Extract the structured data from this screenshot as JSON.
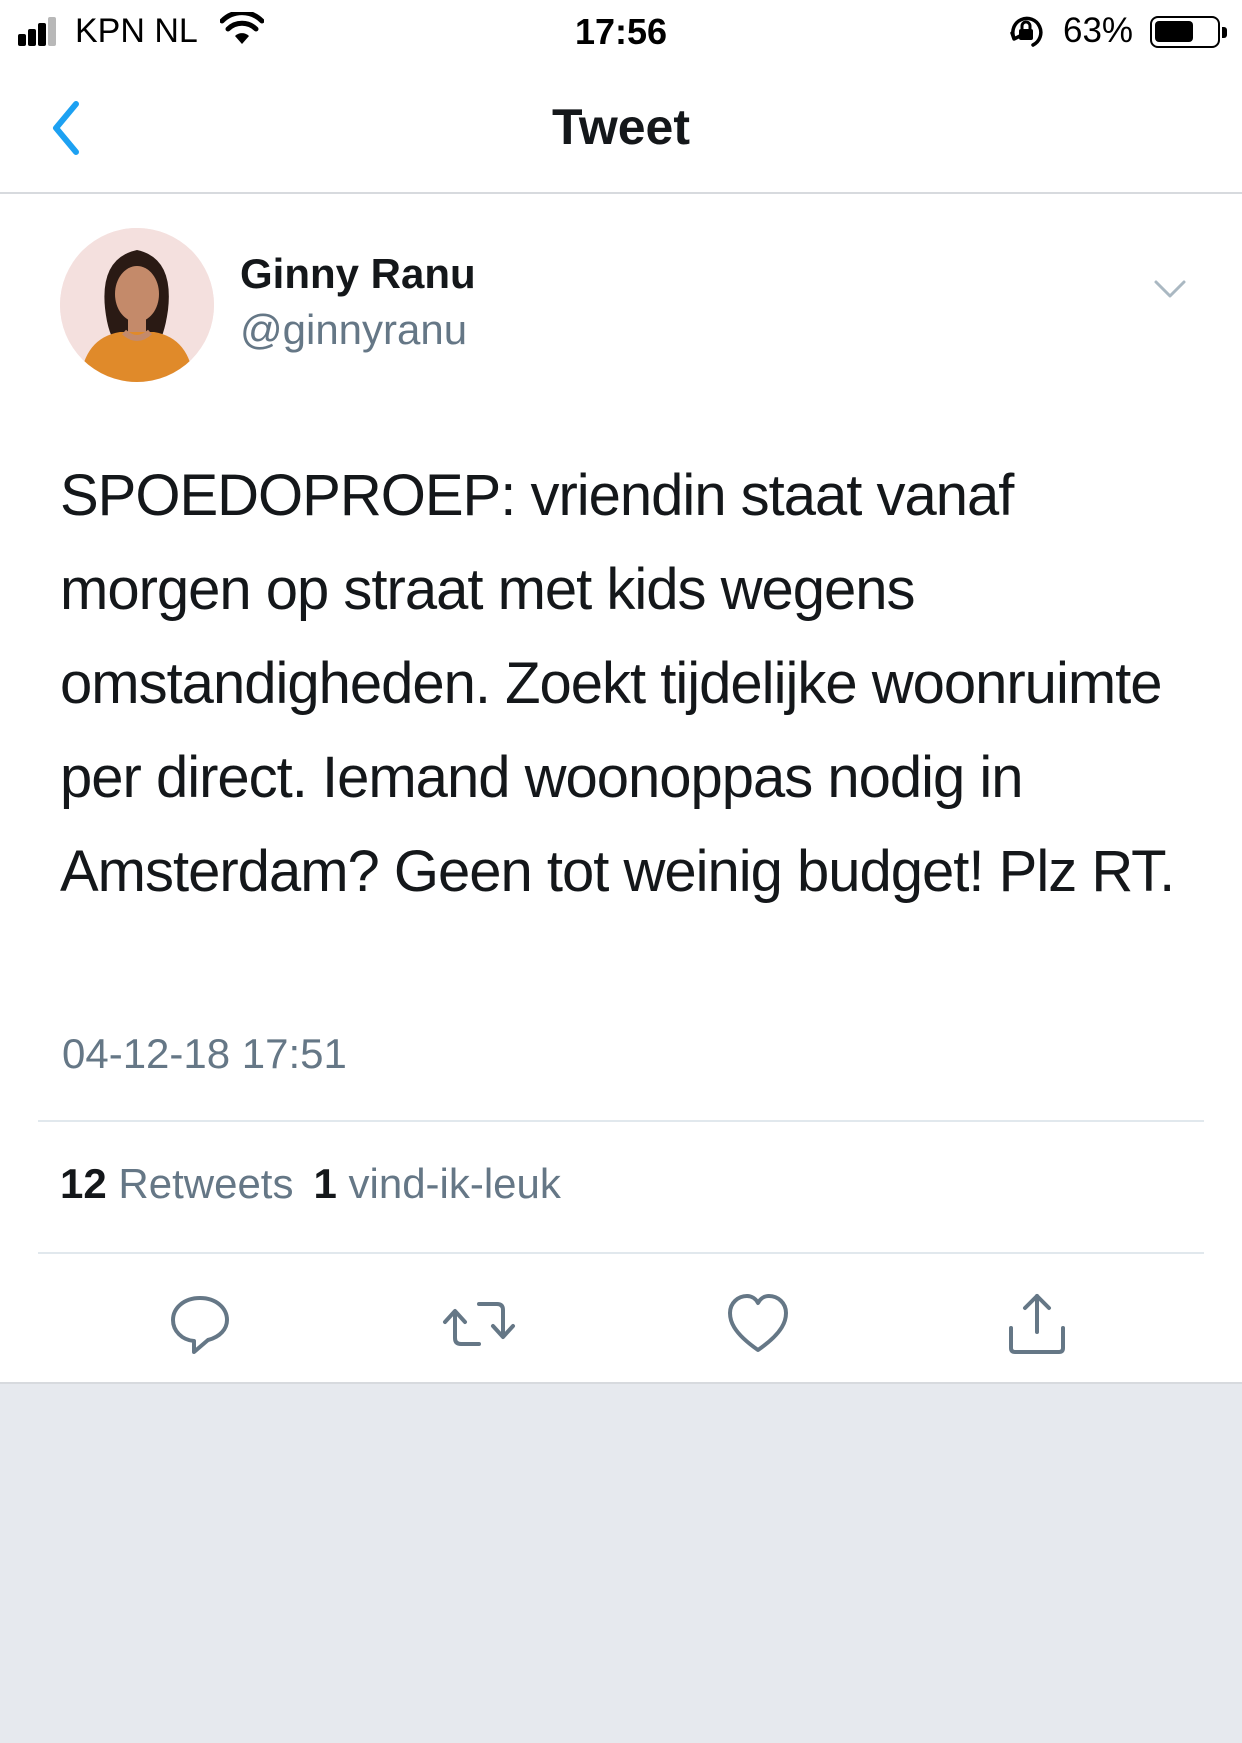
{
  "status_bar": {
    "carrier": "KPN NL",
    "time": "17:56",
    "battery_percent": "63%",
    "battery_level": 0.63,
    "icons": [
      "signal-icon",
      "wifi-icon",
      "orientation-lock-icon",
      "battery-icon"
    ]
  },
  "nav": {
    "title": "Tweet",
    "back_icon": "chevron-left-icon"
  },
  "tweet": {
    "author_name": "Ginny Ranu",
    "author_handle": "@ginnyranu",
    "text": "SPOEDOPROEP: vriendin staat vanaf morgen op straat met kids wegens omstandigheden. Zoekt tijdelijke woonruimte per direct. Iemand woonoppas nodig in Amsterdam? Geen tot weinig budget! Plz RT.",
    "timestamp": "04-12-18 17:51",
    "retweet_count": "12",
    "retweet_label": "Retweets",
    "like_count": "1",
    "like_label": "vind-ik-leuk"
  },
  "actions": [
    "reply-icon",
    "retweet-icon",
    "like-icon",
    "share-icon"
  ],
  "colors": {
    "accent": "#1da1f2",
    "text": "#14171a",
    "secondary": "#657786",
    "background": "#e6e9ee"
  }
}
